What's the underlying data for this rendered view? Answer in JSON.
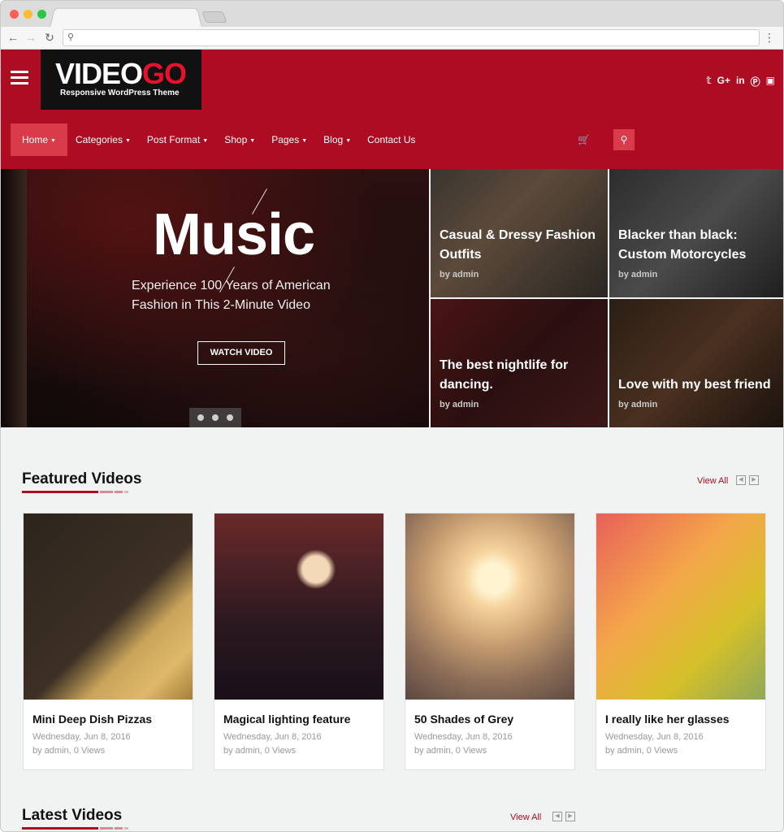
{
  "site": {
    "logo_main": "VIDEO",
    "logo_accent": "GO",
    "logo_tagline": "Responsive WordPress Theme",
    "social": [
      "twitter-icon",
      "google-plus-icon",
      "linkedin-icon",
      "pinterest-icon",
      "instagram-icon"
    ]
  },
  "nav": {
    "items": [
      {
        "label": "Home"
      },
      {
        "label": "Categories"
      },
      {
        "label": "Post Format"
      },
      {
        "label": "Shop"
      },
      {
        "label": "Pages"
      },
      {
        "label": "Blog"
      },
      {
        "label": "Contact Us"
      }
    ]
  },
  "slider": {
    "title": "Music",
    "subtitle": "Experience 100 Years of American Fashion in This 2-Minute Video",
    "button": "WATCH VIDEO"
  },
  "hero_cards": [
    {
      "title": "Casual & Dressy Fashion Outfits",
      "byline": "by admin"
    },
    {
      "title": "Blacker than black: Custom Motorcycles",
      "byline": "by admin"
    },
    {
      "title": "The best nightlife for dancing.",
      "byline": "by admin"
    },
    {
      "title": "Love with my best friend",
      "byline": "by admin"
    }
  ],
  "featured": {
    "title": "Featured Videos",
    "view_all": "View All",
    "items": [
      {
        "title": "Mini Deep Dish Pizzas",
        "date": "Wednesday, Jun 8, 2016",
        "meta": "by admin, 0 Views"
      },
      {
        "title": "Magical lighting feature",
        "date": "Wednesday, Jun 8, 2016",
        "meta": "by admin, 0 Views"
      },
      {
        "title": "50 Shades of Grey",
        "date": "Wednesday, Jun 8, 2016",
        "meta": "by admin, 0 Views"
      },
      {
        "title": "I really like her glasses",
        "date": "Wednesday, Jun 8, 2016",
        "meta": "by admin, 0 Views"
      }
    ]
  },
  "latest": {
    "title": "Latest Videos",
    "view_all": "View All"
  },
  "colors": {
    "brand": "#ad0c22",
    "accent": "#d93b4a"
  }
}
